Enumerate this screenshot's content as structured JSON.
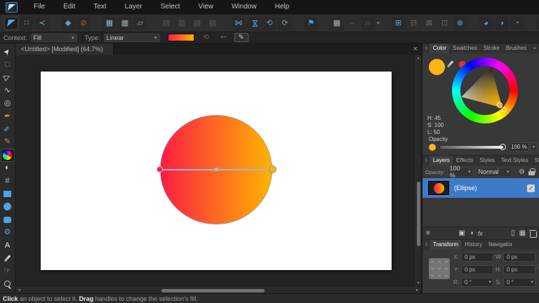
{
  "colors": {
    "accent_blue": "#4da3e8",
    "gradient_start": "#fb1c44",
    "gradient_end": "#ffb400",
    "selection_blue": "#3f7ac9",
    "fill_color": "#fdb515",
    "secondary_color": "#e93223"
  },
  "menu": {
    "items": [
      "File",
      "Edit",
      "Text",
      "Layer",
      "Select",
      "View",
      "Window",
      "Help"
    ]
  },
  "toolbar": {
    "groups": [
      {
        "name": "persona-group",
        "items": [
          {
            "name": "designer-persona-button",
            "kind": "logo",
            "active": true
          },
          {
            "name": "pixel-persona-icon",
            "glyph": "∷",
            "color": "#c9a45c"
          },
          {
            "name": "export-persona-icon",
            "glyph": "≺",
            "color": "#5fb8c9"
          }
        ]
      },
      {
        "name": "insert-group",
        "items": [
          {
            "name": "insert-shape-icon",
            "glyph": "◆",
            "color": "#4da3e8"
          },
          {
            "name": "style-none-icon",
            "glyph": "⊘",
            "color": "#cf4f41"
          }
        ]
      },
      {
        "name": "grid-group",
        "items": [
          {
            "name": "grid-icon",
            "glyph": "▦",
            "color": "#8fb3cf"
          },
          {
            "name": "selection-bounds-icon",
            "glyph": "▩",
            "color": "#9aa7b0"
          },
          {
            "name": "transform-bounds-icon",
            "glyph": "▱",
            "color": "#9aa7b0"
          }
        ]
      },
      {
        "name": "insertion-group",
        "items": [
          {
            "name": "insert-behind-icon",
            "glyph": "▤",
            "color": "#5a5a5a",
            "enabled": false
          },
          {
            "name": "insert-on-top-icon",
            "glyph": "▥",
            "color": "#5a5a5a",
            "enabled": false
          },
          {
            "name": "insert-inside-icon",
            "glyph": "▧",
            "color": "#5a5a5a",
            "enabled": false
          },
          {
            "name": "replace-selection-icon",
            "glyph": "▨",
            "color": "#5a5a5a",
            "enabled": false
          }
        ]
      },
      {
        "name": "flip-rotate-group",
        "items": [
          {
            "name": "flip-horizontal-icon",
            "glyph": "⋈",
            "color": "#4da3e8"
          },
          {
            "name": "flip-vertical-icon",
            "glyph": "⋈",
            "color": "#4da3e8",
            "rot": 90
          },
          {
            "name": "rotate-ccw-icon",
            "glyph": "⟲",
            "color": "#7c98ac"
          },
          {
            "name": "rotate-cw-icon",
            "glyph": "⟳",
            "color": "#7c98ac"
          }
        ]
      },
      {
        "name": "align-group",
        "items": [
          {
            "name": "alignment-icon",
            "glyph": "⚑",
            "color": "#4da3e8"
          }
        ]
      },
      {
        "name": "snapping-group",
        "items": [
          {
            "name": "snap-grid-icon",
            "glyph": "▦",
            "color": "#b0b0b0"
          },
          {
            "name": "snap-separator-icon",
            "glyph": "‒",
            "color": "#6a6a6a",
            "enabled": false
          },
          {
            "name": "snapping-magnet-icon",
            "glyph": "∩",
            "color": "#cf4f41",
            "caret": true
          }
        ]
      },
      {
        "name": "boolean-group",
        "items": [
          {
            "name": "boolean-add-icon",
            "glyph": "⊞",
            "color": "#4da3e8"
          },
          {
            "name": "boolean-subtract-icon",
            "glyph": "⊟",
            "color": "#676767",
            "enabled": false
          },
          {
            "name": "boolean-intersect-icon",
            "glyph": "⊠",
            "color": "#676767",
            "enabled": false
          },
          {
            "name": "boolean-divide-icon",
            "glyph": "⊡",
            "color": "#676767",
            "enabled": false
          },
          {
            "name": "boolean-combine-icon",
            "glyph": "⊕",
            "color": "#4da3e8"
          }
        ]
      },
      {
        "name": "geometry-group",
        "items": [
          {
            "name": "geometry-merge-icon",
            "glyph": "◕",
            "color": "#4da3e8"
          },
          {
            "name": "geometry-overlap-icon",
            "glyph": "◑",
            "color": "#4da3e8"
          },
          {
            "name": "geometry-divide-icon",
            "glyph": "◔",
            "color": "#4da3e8"
          }
        ]
      },
      {
        "name": "account-group",
        "items": [
          {
            "name": "account-icon",
            "kind": "person"
          }
        ]
      }
    ]
  },
  "context_bar": {
    "context_label": "Context:",
    "context_value": "Fill",
    "type_label": "Type:",
    "type_value": "Linear",
    "icons": [
      {
        "name": "rotate-fill-icon",
        "glyph": "⟲",
        "enabled": false
      },
      {
        "name": "reverse-gradient-icon",
        "glyph": "↩",
        "enabled": false
      },
      {
        "name": "edit-gradient-icon",
        "glyph": "✎",
        "enabled": true,
        "boxed": true
      }
    ]
  },
  "document_tab": {
    "title": "<Untitled> [Modified] (64.7%)",
    "close_glyph": "×"
  },
  "tools": [
    {
      "name": "move-tool",
      "glyph": "➤",
      "color": "#e3e3e3",
      "rot": -50
    },
    {
      "name": "artboard-tool",
      "glyph": "□",
      "color": "#4da3e8"
    },
    {
      "name": "node-tool",
      "glyph": "▷",
      "color": "#f0f0f0",
      "rot": -25
    },
    {
      "name": "corner-tool",
      "glyph": "∿",
      "color": "#d0d0d0"
    },
    {
      "name": "point-transform-tool",
      "glyph": "◎",
      "color": "#d0d0d0"
    },
    {
      "name": "pen-tool",
      "glyph": "✒",
      "color": "#d9a441"
    },
    {
      "name": "pencil-tool",
      "glyph": "✏",
      "color": "#5aa7e8",
      "rot": -45
    },
    {
      "name": "vector-brush-tool",
      "glyph": "✎",
      "color": "#c98f5a"
    },
    {
      "name": "fill-tool",
      "kind": "wheel",
      "active": true
    },
    {
      "name": "transparency-tool",
      "glyph": "◐",
      "color": "#e6e6e6"
    },
    {
      "name": "vector-crop-tool",
      "glyph": "#",
      "color": "#c0c0c0"
    },
    {
      "name": "rectangle-tool",
      "kind": "rect",
      "color": "#4da3e8"
    },
    {
      "name": "ellipse-tool",
      "kind": "circle",
      "color": "#4da3e8"
    },
    {
      "name": "rounded-rectangle-tool",
      "kind": "rounded",
      "color": "#4da3e8"
    },
    {
      "name": "shapes-tool",
      "glyph": "⚙",
      "color": "#4da3e8"
    },
    {
      "name": "text-tool",
      "glyph": "A",
      "color": "#ececec"
    },
    {
      "name": "color-picker-tool",
      "kind": "eyedropper"
    },
    {
      "name": "view-tool",
      "glyph": "☞",
      "color": "#d9b68c"
    },
    {
      "name": "zoom-tool",
      "kind": "magnifier"
    }
  ],
  "color_panel": {
    "tabs": [
      "Color",
      "Swatches",
      "Stroke",
      "Brushes"
    ],
    "active_tab": "Color",
    "hue": "H: 45",
    "saturation": "S: 100",
    "lightness": "L: 50",
    "opacity_label": "Opacity",
    "opacity_value": "100 %"
  },
  "layers_panel": {
    "tabs": [
      "Layers",
      "Effects",
      "Styles",
      "Text Styles",
      "Stock"
    ],
    "active_tab": "Layers",
    "opacity_label": "Opacity:",
    "opacity_value": "100 %",
    "blend_mode": "Normal",
    "layers": [
      {
        "name": "(Ellipse)",
        "selected": true,
        "visible": true
      }
    ],
    "footer_icons": [
      {
        "name": "layer-stack-icon",
        "glyph": "≡"
      },
      {
        "spacer": true
      },
      {
        "name": "mask-layer-icon",
        "glyph": "▣"
      },
      {
        "name": "adjustment-layer-icon",
        "glyph": "◑"
      },
      {
        "name": "layer-effects-icon",
        "glyph": "fx",
        "fx": true
      },
      {
        "spacer": true
      },
      {
        "name": "new-layer-icon",
        "glyph": "▯"
      },
      {
        "name": "pattern-layer-icon",
        "glyph": "▦"
      },
      {
        "name": "delete-layer-icon",
        "kind": "trash"
      }
    ]
  },
  "transform_panel": {
    "tabs": [
      "Transform",
      "History",
      "Navigator"
    ],
    "active_tab": "Transform",
    "fields": [
      {
        "label": "X:",
        "value": "0 px"
      },
      {
        "label": "W:",
        "value": "0 px"
      },
      {
        "label": "Y:",
        "value": "0 px"
      },
      {
        "label": "H:",
        "value": "0 px"
      },
      {
        "label": "R:",
        "value": "0 °",
        "caret": true
      },
      {
        "label": "S:",
        "value": "0 °",
        "caret": true
      }
    ]
  },
  "status_bar": {
    "parts": [
      {
        "text": "Click",
        "bold": true
      },
      {
        "text": " an object to select it. ",
        "bold": false
      },
      {
        "text": "Drag",
        "bold": true
      },
      {
        "text": " handles to change the selection's fill.",
        "bold": false
      }
    ]
  },
  "icons": {
    "caret": "▾",
    "up": "▴",
    "down": "▾",
    "left": "◂",
    "right": "▸",
    "gear": "⚙",
    "menu": "▪",
    "handle": "‖",
    "check": "✓"
  }
}
